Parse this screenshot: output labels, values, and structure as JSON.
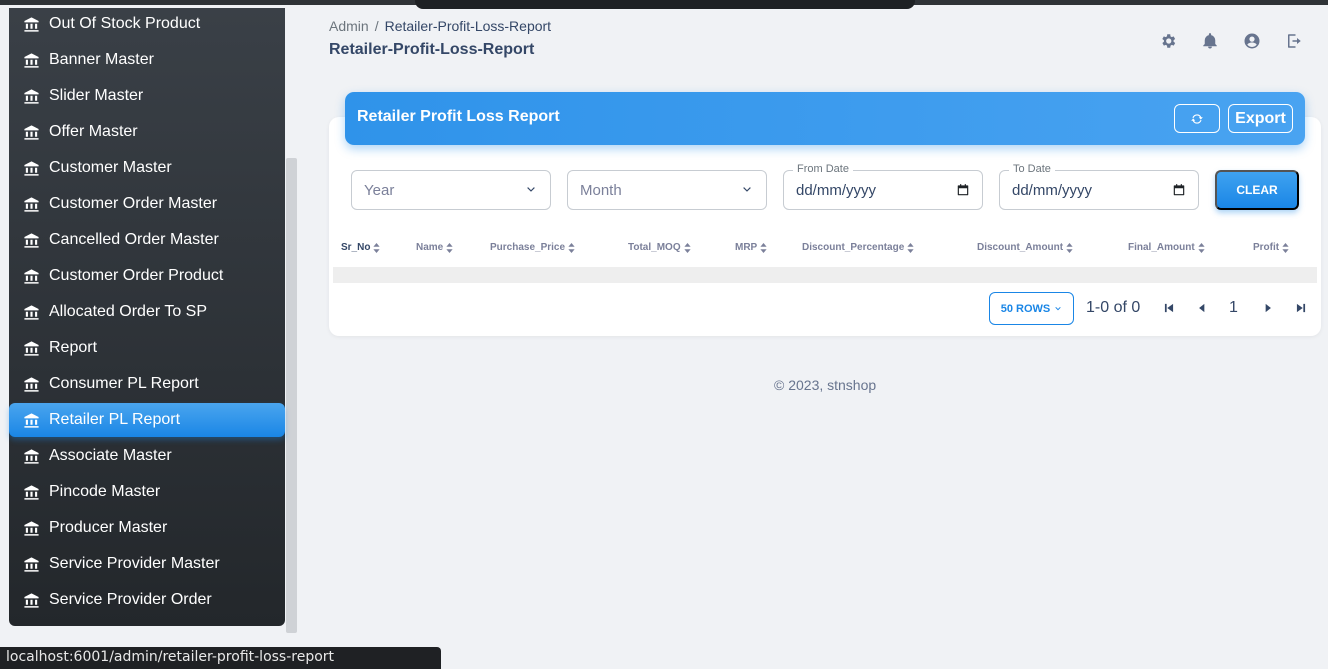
{
  "sidebar": {
    "items": [
      {
        "label": "Out Of Stock Product",
        "active": false
      },
      {
        "label": "Banner Master",
        "active": false
      },
      {
        "label": "Slider Master",
        "active": false
      },
      {
        "label": "Offer Master",
        "active": false
      },
      {
        "label": "Customer Master",
        "active": false
      },
      {
        "label": "Customer Order Master",
        "active": false
      },
      {
        "label": "Cancelled Order Master",
        "active": false
      },
      {
        "label": "Customer Order Product",
        "active": false
      },
      {
        "label": "Allocated Order To SP",
        "active": false
      },
      {
        "label": "Report",
        "active": false
      },
      {
        "label": "Consumer PL Report",
        "active": false
      },
      {
        "label": "Retailer PL Report",
        "active": true
      },
      {
        "label": "Associate Master",
        "active": false
      },
      {
        "label": "Pincode Master",
        "active": false
      },
      {
        "label": "Producer Master",
        "active": false
      },
      {
        "label": "Service Provider Master",
        "active": false
      },
      {
        "label": "Service Provider Order",
        "active": false
      }
    ]
  },
  "header": {
    "breadcrumb_root": "Admin",
    "breadcrumb_sep": "/",
    "breadcrumb_current": "Retailer-Profit-Loss-Report",
    "title": "Retailer-Profit-Loss-Report"
  },
  "card": {
    "title": "Retailer Profit Loss Report",
    "export_label": "Export"
  },
  "filters": {
    "year_placeholder": "Year",
    "month_placeholder": "Month",
    "from_date_label": "From Date",
    "from_date_value": "dd/mm/yyyy",
    "to_date_label": "To Date",
    "to_date_value": "dd/mm/yyyy",
    "clear_label": "CLEAR"
  },
  "table": {
    "columns": [
      "Sr_No",
      "Name",
      "Purchase_Price",
      "Total_MOQ",
      "MRP",
      "Discount_Percentage",
      "Discount_Amount",
      "Final_Amount",
      "Profit"
    ]
  },
  "pagination": {
    "rows_label": "50 ROWS",
    "range": "1-0 of 0",
    "page": "1"
  },
  "footer": {
    "text": "© 2023, stnshop"
  },
  "status_bar": {
    "url": "localhost:6001/admin/retailer-profit-loss-report"
  },
  "colors": {
    "accent": "#1a86e6",
    "sidebar_bg": "#2f3439",
    "page_bg": "#f0f2f5"
  }
}
